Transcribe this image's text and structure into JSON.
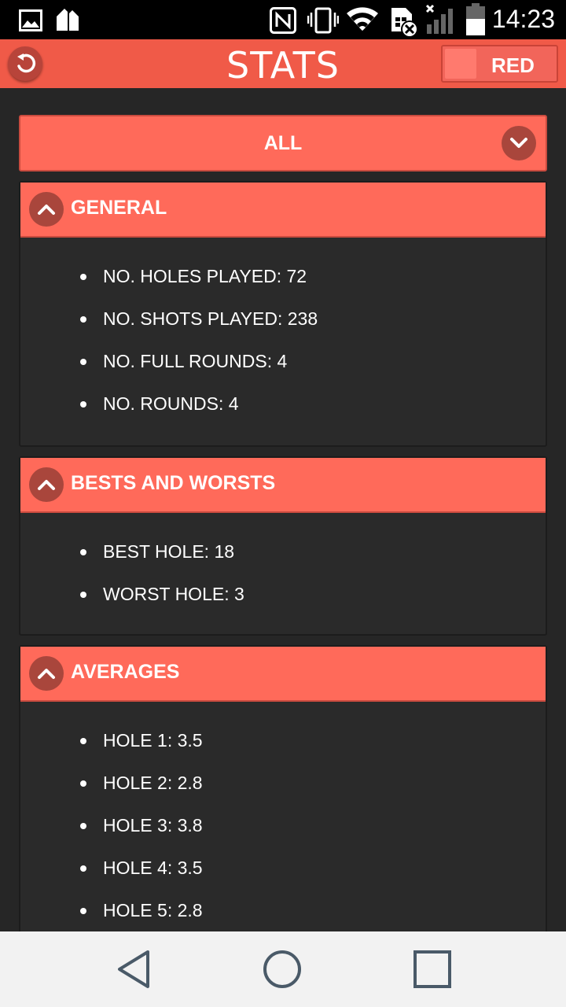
{
  "status_bar": {
    "time": "14:23",
    "icons": [
      "gallery-icon",
      "app-store-icon",
      "nfc-icon",
      "vibrate-icon",
      "wifi-icon",
      "sim-error-icon",
      "signal-icon",
      "battery-icon"
    ]
  },
  "app_bar": {
    "title": "STATS",
    "back_icon": "back-arrow-icon",
    "team_toggle_label": "RED"
  },
  "filter": {
    "selected": "ALL",
    "icon": "chevron-down-icon"
  },
  "sections": [
    {
      "title": "GENERAL",
      "icon": "chevron-up-icon",
      "items": [
        "NO. HOLES PLAYED: 72",
        "NO. SHOTS PLAYED: 238",
        "NO. FULL ROUNDS: 4",
        "NO. ROUNDS: 4"
      ]
    },
    {
      "title": "BESTS AND WORSTS",
      "icon": "chevron-up-icon",
      "items": [
        "BEST HOLE: 18",
        "WORST HOLE: 3"
      ]
    },
    {
      "title": "AVERAGES",
      "icon": "chevron-up-icon",
      "items": [
        "HOLE 1: 3.5",
        "HOLE 2: 2.8",
        "HOLE 3: 3.8",
        "HOLE 4: 3.5",
        "HOLE 5: 2.8"
      ]
    }
  ],
  "nav_bar": {
    "icons": [
      "nav-back-icon",
      "nav-home-icon",
      "nav-recents-icon"
    ]
  },
  "colors": {
    "accent": "#ff6a5a",
    "app_bar": "#f05a48",
    "background": "#262626"
  }
}
